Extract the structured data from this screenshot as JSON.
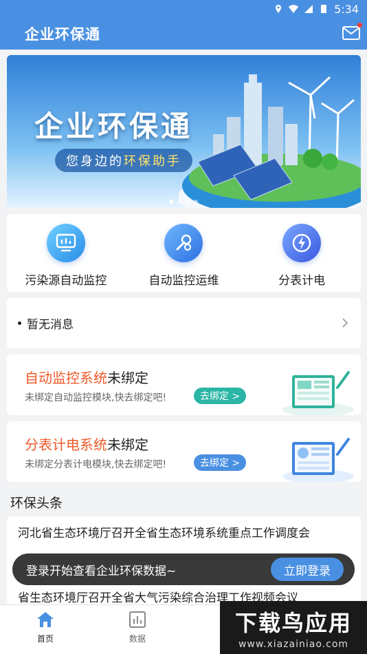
{
  "status_bar": {
    "time": "5:34"
  },
  "app_bar": {
    "title": "企业环保通"
  },
  "banner": {
    "title": "企业环保通",
    "subtitle_part1": "您身边的",
    "subtitle_highlight": "环保助手",
    "slide_count": 4,
    "active_slide": 1
  },
  "quick_actions": [
    {
      "label": "污染源自动监控",
      "icon": "monitor-chart-icon",
      "color": "#3aa0f0"
    },
    {
      "label": "自动监控运维",
      "icon": "wrench-gear-icon",
      "color": "#3a86f0"
    },
    {
      "label": "分表计电",
      "icon": "lightning-icon",
      "color": "#4a6cf0"
    }
  ],
  "notice": {
    "text": "暂无消息"
  },
  "cards": [
    {
      "title_highlight": "自动监控系统",
      "title_rest": "未绑定",
      "subtitle": "未绑定自动监控模块,快去绑定吧!",
      "button": "去绑定 >",
      "button_color": "#2bb5a6"
    },
    {
      "title_highlight": "分表计电系统",
      "title_rest": "未绑定",
      "subtitle": "未绑定分表计电模块,快去绑定吧!",
      "button": "去绑定 >",
      "button_color": "#4a90e2"
    }
  ],
  "news": {
    "section_title": "环保头条",
    "items": [
      "河北省生态环境厅召开全省生态环境系统重点工作调度会",
      "省生态环境厅召开全省大气污染综合治理工作视频会议"
    ]
  },
  "toast": {
    "text": "登录开始查看企业环保数据~",
    "button": "立即登录"
  },
  "tabs": [
    {
      "label": "首页",
      "icon": "home-icon",
      "active": true
    },
    {
      "label": "数据",
      "icon": "bar-chart-icon",
      "active": false
    }
  ],
  "watermark": {
    "line1": "下载鸟应用",
    "line2": "www.xiazainiao.com"
  },
  "colors": {
    "primary": "#4a90e2",
    "highlight": "#f05a28",
    "toast_bg": "#282828"
  }
}
